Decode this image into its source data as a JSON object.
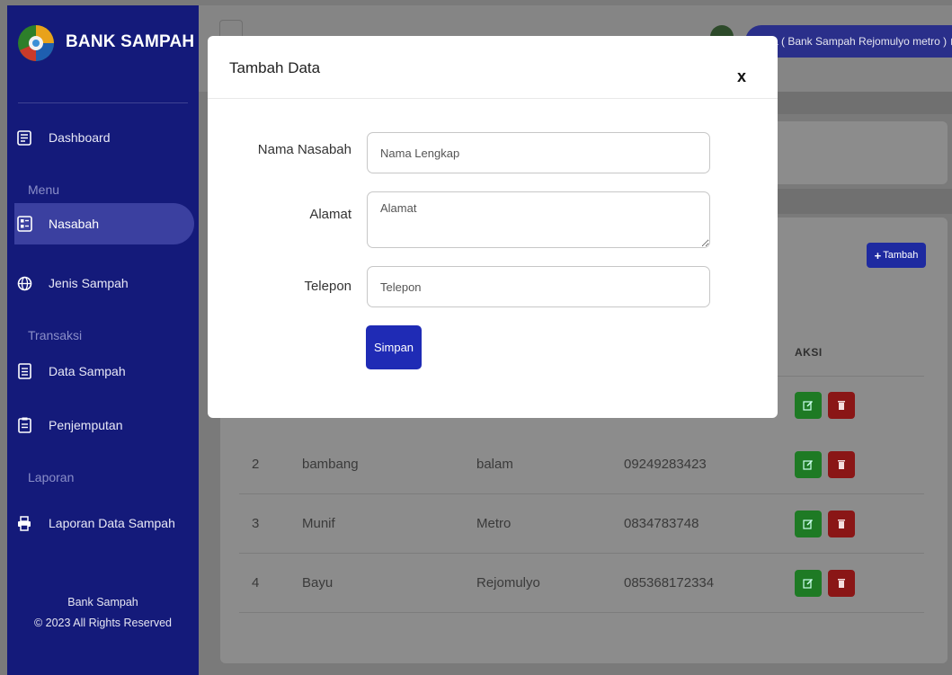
{
  "brand": {
    "name": "BANK SAMPAH"
  },
  "sidebar": {
    "dashboard": "Dashboard",
    "heading_menu": "Menu",
    "nasabah": "Nasabah",
    "jenis_sampah": "Jenis Sampah",
    "heading_transaksi": "Transaksi",
    "data_sampah": "Data Sampah",
    "penjemputan": "Penjemputan",
    "heading_laporan": "Laporan",
    "laporan_data_sampah": "Laporan Data Sampah",
    "footer_title": "Bank Sampah",
    "footer_copy": "© 2023 All Rights Reserved"
  },
  "topbar": {
    "user_label": "itra ( Bank Sampah Rejomulyo metro )"
  },
  "content": {
    "add_button": "Tambah",
    "col_aksi": "AKSI",
    "rows": [
      {
        "no": "2",
        "nama": "bambang",
        "alamat": "balam",
        "telepon": "09249283423"
      },
      {
        "no": "3",
        "nama": "Munif",
        "alamat": "Metro",
        "telepon": "0834783748"
      },
      {
        "no": "4",
        "nama": "Bayu",
        "alamat": "Rejomulyo",
        "telepon": "085368172334"
      }
    ]
  },
  "modal": {
    "title": "Tambah Data",
    "close": "x",
    "nama_label": "Nama Nasabah",
    "nama_placeholder": "Nama Lengkap",
    "alamat_label": "Alamat",
    "alamat_placeholder": "Alamat",
    "telepon_label": "Telepon",
    "telepon_placeholder": "Telepon",
    "save_label": "Simpan"
  },
  "colors": {
    "sidebar": "#141a7a",
    "primary": "#1f2bb5",
    "edit": "#28a745",
    "delete": "#dc3545"
  }
}
